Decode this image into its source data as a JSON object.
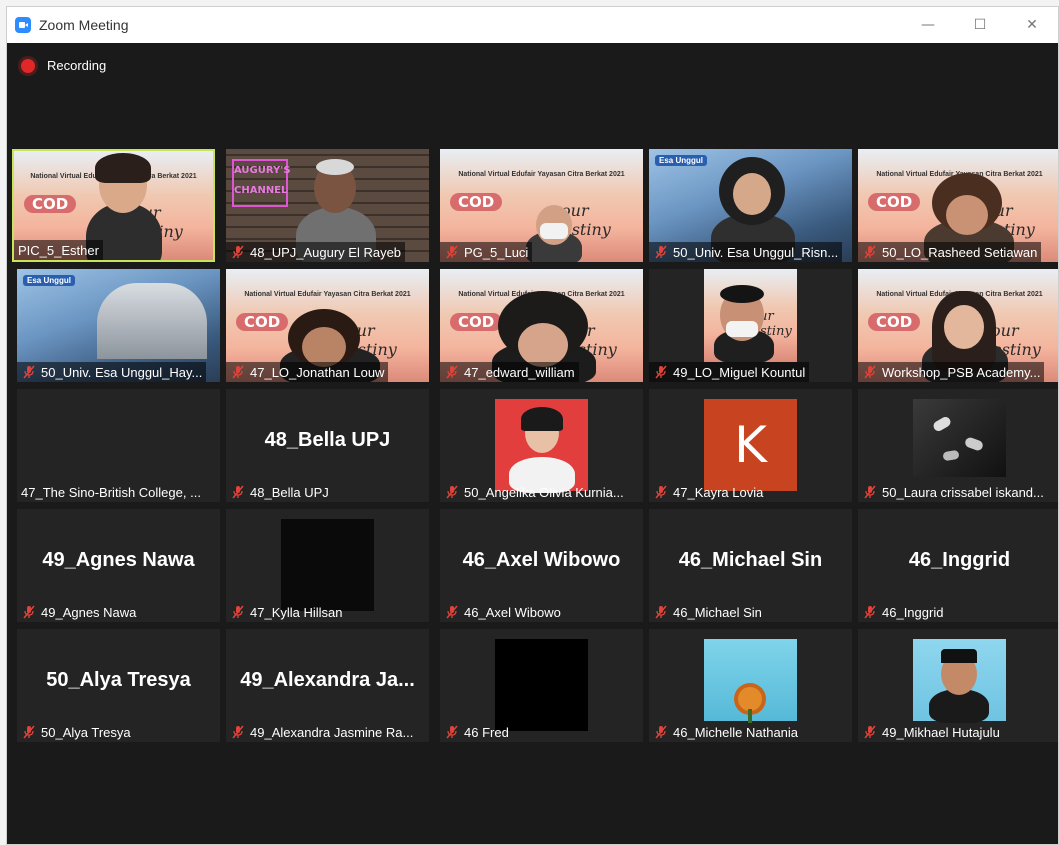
{
  "window": {
    "title": "Zoom Meeting"
  },
  "window_controls": {
    "minimize": "—",
    "maximize": "☐",
    "close": "✕"
  },
  "recording": {
    "label": "Recording"
  },
  "participants": [
    {
      "name": "PIC_5_Esther",
      "muted": false,
      "big_name": ""
    },
    {
      "name": "48_UPJ_Augury El Rayeb",
      "muted": true,
      "big_name": ""
    },
    {
      "name": "PG_5_Luci",
      "muted": true,
      "big_name": ""
    },
    {
      "name": "50_Univ. Esa Unggul_Risn...",
      "muted": true,
      "big_name": ""
    },
    {
      "name": "50_LO_Rasheed Setiawan",
      "muted": true,
      "big_name": ""
    },
    {
      "name": "50_Univ. Esa Unggul_Hay...",
      "muted": true,
      "big_name": ""
    },
    {
      "name": "47_LO_Jonathan Louw",
      "muted": true,
      "big_name": ""
    },
    {
      "name": "47_edward_william",
      "muted": true,
      "big_name": ""
    },
    {
      "name": "49_LO_Miguel Kountul",
      "muted": true,
      "big_name": ""
    },
    {
      "name": "Workshop_PSB Academy...",
      "muted": true,
      "big_name": ""
    },
    {
      "name": "47_The Sino-British College, ...",
      "muted": false,
      "big_name": ""
    },
    {
      "name": "48_Bella UPJ",
      "muted": true,
      "big_name": "48_Bella UPJ"
    },
    {
      "name": "50_Angelika Olivia Kurnia...",
      "muted": true,
      "big_name": ""
    },
    {
      "name": "47_Kayra Lovia",
      "muted": true,
      "big_name": "",
      "avatar_letter": "K"
    },
    {
      "name": "50_Laura crissabel iskand...",
      "muted": true,
      "big_name": ""
    },
    {
      "name": "49_Agnes Nawa",
      "muted": true,
      "big_name": "49_Agnes Nawa"
    },
    {
      "name": "47_Kylla Hillsan",
      "muted": true,
      "big_name": ""
    },
    {
      "name": "46_Axel Wibowo",
      "muted": true,
      "big_name": "46_Axel Wibowo"
    },
    {
      "name": "46_Michael Sin",
      "muted": true,
      "big_name": "46_Michael Sin"
    },
    {
      "name": "46_Inggrid",
      "muted": true,
      "big_name": "46_Inggrid"
    },
    {
      "name": "50_Alya Tresya",
      "muted": true,
      "big_name": "50_Alya Tresya"
    },
    {
      "name": "49_Alexandra Jasmine Ra...",
      "muted": true,
      "big_name": "49_Alexandra Ja..."
    },
    {
      "name": "46 Fred",
      "muted": true,
      "big_name": ""
    },
    {
      "name": "46_Michelle Nathania",
      "muted": true,
      "big_name": ""
    },
    {
      "name": "49_Mikhael Hutajulu",
      "muted": true,
      "big_name": ""
    }
  ],
  "banner": {
    "title": "National Virtual Edufair Yayasan Citra Berkat 2021",
    "badge": "COD",
    "script": "your destiny",
    "sponsor": "Esa Unggul",
    "channel": "AUGURY'S CHANNEL"
  },
  "colors": {
    "accent_active": "#c8e45a",
    "muted_icon": "#e0433a",
    "recording": "#e02828",
    "tile_bg": "#242424"
  }
}
